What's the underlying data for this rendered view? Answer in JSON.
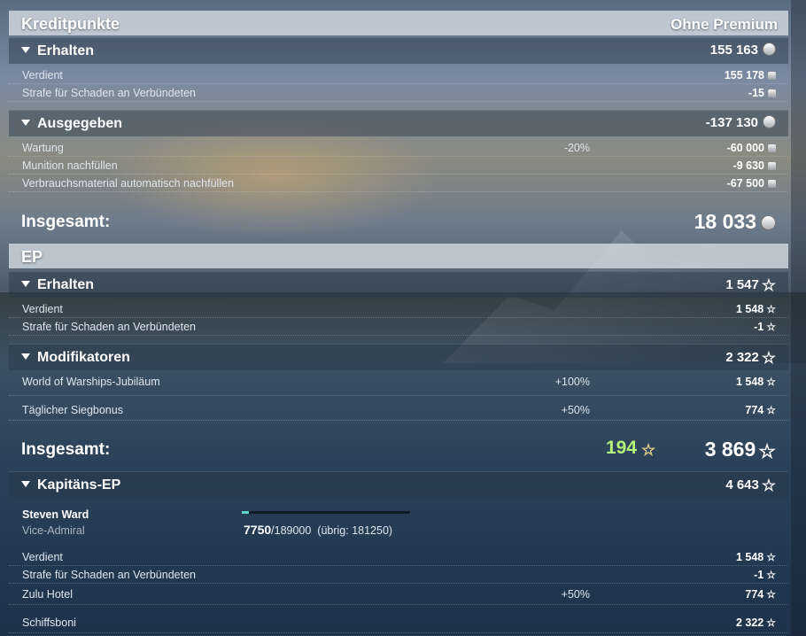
{
  "kredit": {
    "title": "Kreditpunkte",
    "column_label": "Ohne Premium",
    "erhalten": {
      "label": "Erhalten",
      "value": "155 163",
      "items": [
        {
          "label": "Verdient",
          "value": "155 178"
        },
        {
          "label": "Strafe für Schaden an Verbündeten",
          "value": "-15"
        }
      ]
    },
    "ausgegeben": {
      "label": "Ausgegeben",
      "value": "-137 130",
      "items": [
        {
          "label": "Wartung",
          "percent": "-20%",
          "value": "-60 000"
        },
        {
          "label": "Munition nachfüllen",
          "value": "-9 630"
        },
        {
          "label": "Verbrauchsmaterial automatisch nachfüllen",
          "value": "-67 500"
        }
      ]
    },
    "total": {
      "label": "Insgesamt:",
      "value": "18 033"
    }
  },
  "ep": {
    "title": "EP",
    "erhalten": {
      "label": "Erhalten",
      "value": "1 547",
      "items": [
        {
          "label": "Verdient",
          "value": "1 548"
        },
        {
          "label": "Strafe für Schaden an Verbündeten",
          "value": "-1"
        }
      ]
    },
    "modifikatoren": {
      "label": "Modifikatoren",
      "value": "2 322",
      "items": [
        {
          "label": "World of Warships-Jubiläum",
          "percent": "+100%",
          "value": "1 548"
        },
        {
          "label": "Täglicher Siegbonus",
          "percent": "+50%",
          "value": "774"
        }
      ]
    },
    "total": {
      "label": "Insgesamt:",
      "free_value": "194",
      "value": "3 869"
    }
  },
  "kapitaen": {
    "label": "Kapitäns-EP",
    "value": "4 643",
    "name": "Steven Ward",
    "rank": "Vice-Admiral",
    "progress_current": "7750",
    "progress_total": "/189000",
    "progress_remaining": "(übrig: 181250)",
    "progress_fraction": 0.041,
    "items": [
      {
        "label": "Verdient",
        "value": "1 548"
      },
      {
        "label": "Strafe für Schaden an Verbündeten",
        "value": "-1"
      },
      {
        "label": "Zulu Hotel",
        "percent": "+50%",
        "value": "774"
      },
      {
        "label": "Schiffsboni",
        "value": "2 322"
      }
    ]
  },
  "colors": {
    "free_xp": "#b4f47a",
    "progress_bar": "#5fd4c8",
    "header_bg": "#d7dee6"
  }
}
